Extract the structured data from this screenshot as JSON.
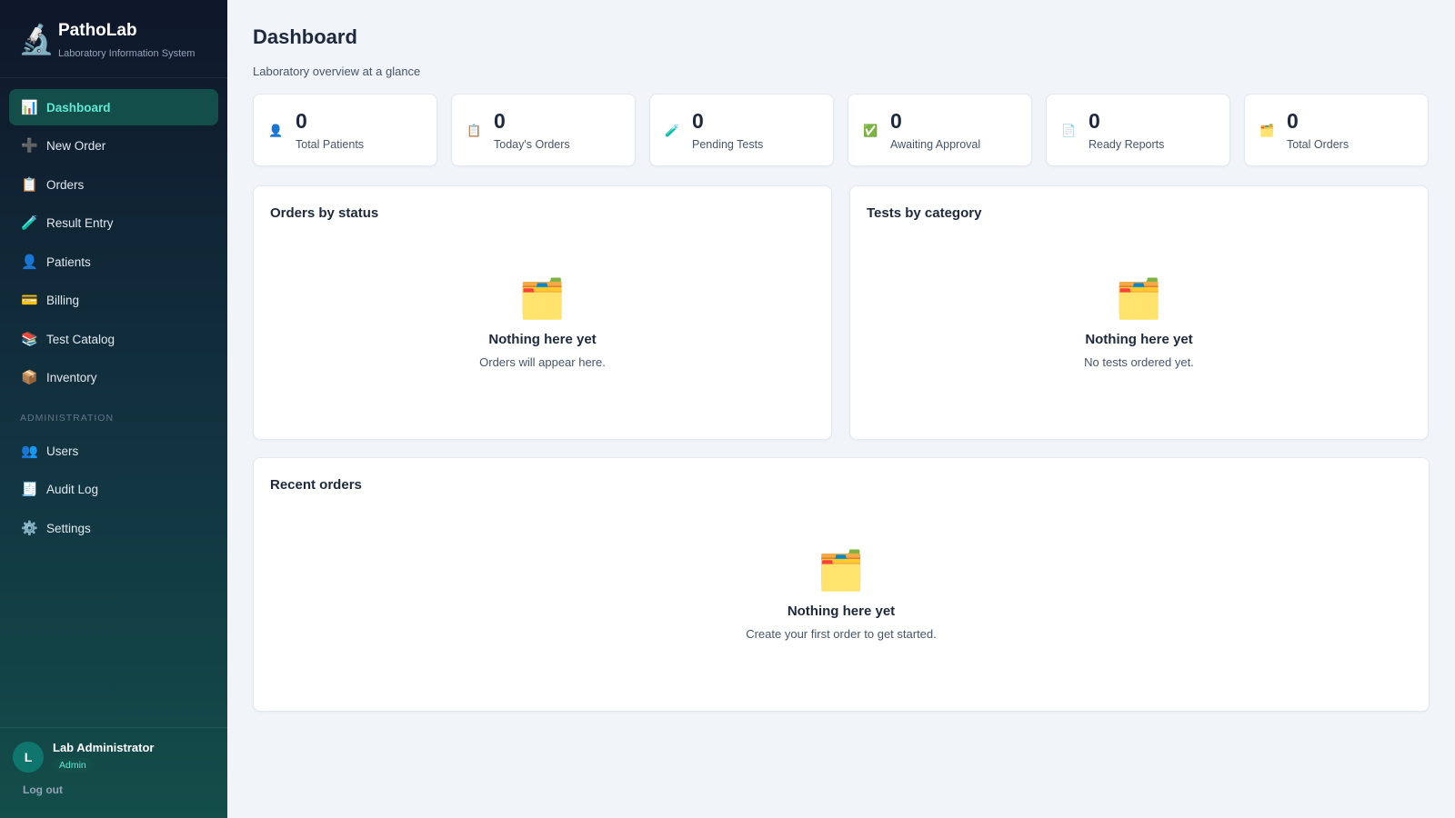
{
  "brand": {
    "icon": "microscope-icon",
    "name": "PathoLab",
    "subtitle": "Laboratory Information System"
  },
  "nav": {
    "items": [
      {
        "label": "Dashboard",
        "icon": "chart-icon",
        "active": true
      },
      {
        "label": "New Order",
        "icon": "plus-icon"
      },
      {
        "label": "Orders",
        "icon": "clipboard-icon"
      },
      {
        "label": "Result Entry",
        "icon": "test-tube-icon"
      },
      {
        "label": "Patients",
        "icon": "person-icon"
      },
      {
        "label": "Billing",
        "icon": "credit-card-icon"
      },
      {
        "label": "Test Catalog",
        "icon": "books-icon"
      },
      {
        "label": "Inventory",
        "icon": "package-icon"
      }
    ],
    "admin_section": "ADMINISTRATION",
    "admin_items": [
      {
        "label": "Users",
        "icon": "users-icon"
      },
      {
        "label": "Audit Log",
        "icon": "receipt-icon"
      },
      {
        "label": "Settings",
        "icon": "gear-icon"
      }
    ]
  },
  "user": {
    "initial": "L",
    "name": "Lab Administrator",
    "role": "Admin",
    "logout": "Log out"
  },
  "header": {
    "title": "Dashboard",
    "subtitle": "Laboratory overview at a glance"
  },
  "stats": [
    {
      "value": "0",
      "label": "Total Patients",
      "icon": "person-icon"
    },
    {
      "value": "0",
      "label": "Today's Orders",
      "icon": "clipboard-icon"
    },
    {
      "value": "0",
      "label": "Pending Tests",
      "icon": "test-tube-icon"
    },
    {
      "value": "0",
      "label": "Awaiting Approval",
      "icon": "check-icon"
    },
    {
      "value": "0",
      "label": "Ready Reports",
      "icon": "document-icon"
    },
    {
      "value": "0",
      "label": "Total Orders",
      "icon": "folder-icon"
    }
  ],
  "panels": {
    "orders_by_status": {
      "title": "Orders by status",
      "empty_title": "Nothing here yet",
      "empty_sub": "Orders will appear here."
    },
    "tests_by_category": {
      "title": "Tests by category",
      "empty_title": "Nothing here yet",
      "empty_sub": "No tests ordered yet."
    },
    "recent_orders": {
      "title": "Recent orders",
      "empty_title": "Nothing here yet",
      "empty_sub": "Create your first order to get started."
    }
  },
  "colors": {
    "accent": "#5eead4",
    "sidebar_dark": "#0f172a",
    "sidebar_teal": "#134e4a",
    "avatar": "#0f766e"
  }
}
